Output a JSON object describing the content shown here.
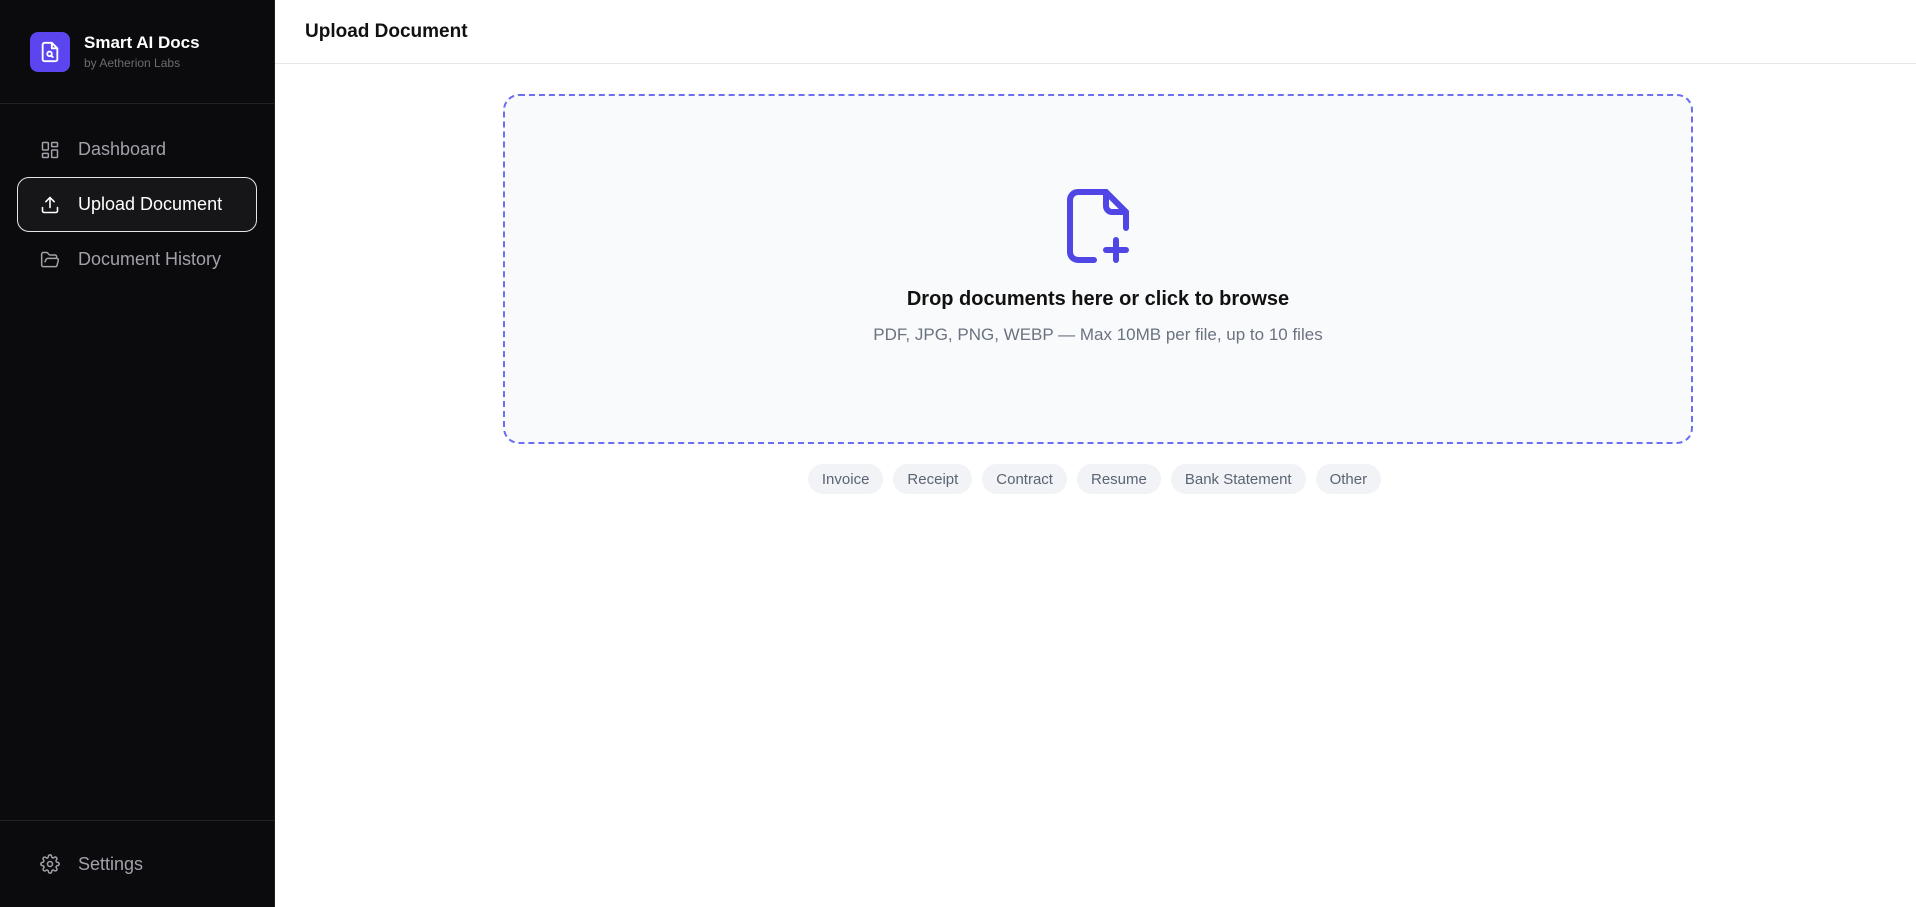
{
  "brand": {
    "name": "Smart AI Docs",
    "subtitle": "by Aetherion Labs",
    "accent": "#5b45ee"
  },
  "sidebar": {
    "items": [
      {
        "label": "Dashboard",
        "icon": "dashboard-grid-icon",
        "active": false
      },
      {
        "label": "Upload Document",
        "icon": "upload-icon",
        "active": true
      },
      {
        "label": "Document History",
        "icon": "folder-open-icon",
        "active": false
      }
    ],
    "footer": {
      "label": "Settings",
      "icon": "gear-icon"
    }
  },
  "header": {
    "title": "Upload Document"
  },
  "dropzone": {
    "icon": "file-plus-icon",
    "title": "Drop documents here or click to browse",
    "subtitle": "PDF, JPG, PNG, WEBP — Max 10MB per file, up to 10 files",
    "border_color": "#6b6ff0"
  },
  "document_types": [
    "Invoice",
    "Receipt",
    "Contract",
    "Resume",
    "Bank Statement",
    "Other"
  ]
}
